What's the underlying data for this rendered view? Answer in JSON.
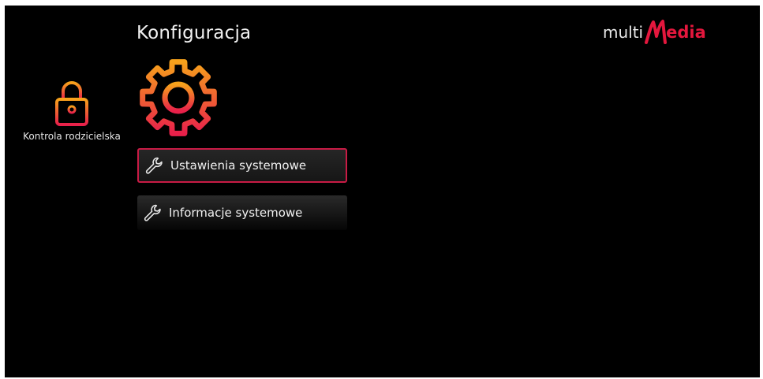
{
  "header": {
    "title": "Konfiguracja"
  },
  "brand": {
    "prefix": "multi",
    "letter": "M",
    "suffix": "edia",
    "accent_color": "#e4173d"
  },
  "sidebar": {
    "items": [
      {
        "label": "Kontrola rodzicielska",
        "icon": "lock-icon"
      }
    ]
  },
  "section": {
    "icon": "gear-icon",
    "gradient_colors": [
      "#f7a21b",
      "#e8204a"
    ]
  },
  "menu": {
    "selected_index": 0,
    "selected_border_color": "#c81b45",
    "items": [
      {
        "label": "Ustawienia systemowe",
        "icon": "wrench-icon"
      },
      {
        "label": "Informacje systemowe",
        "icon": "wrench-icon"
      }
    ]
  }
}
